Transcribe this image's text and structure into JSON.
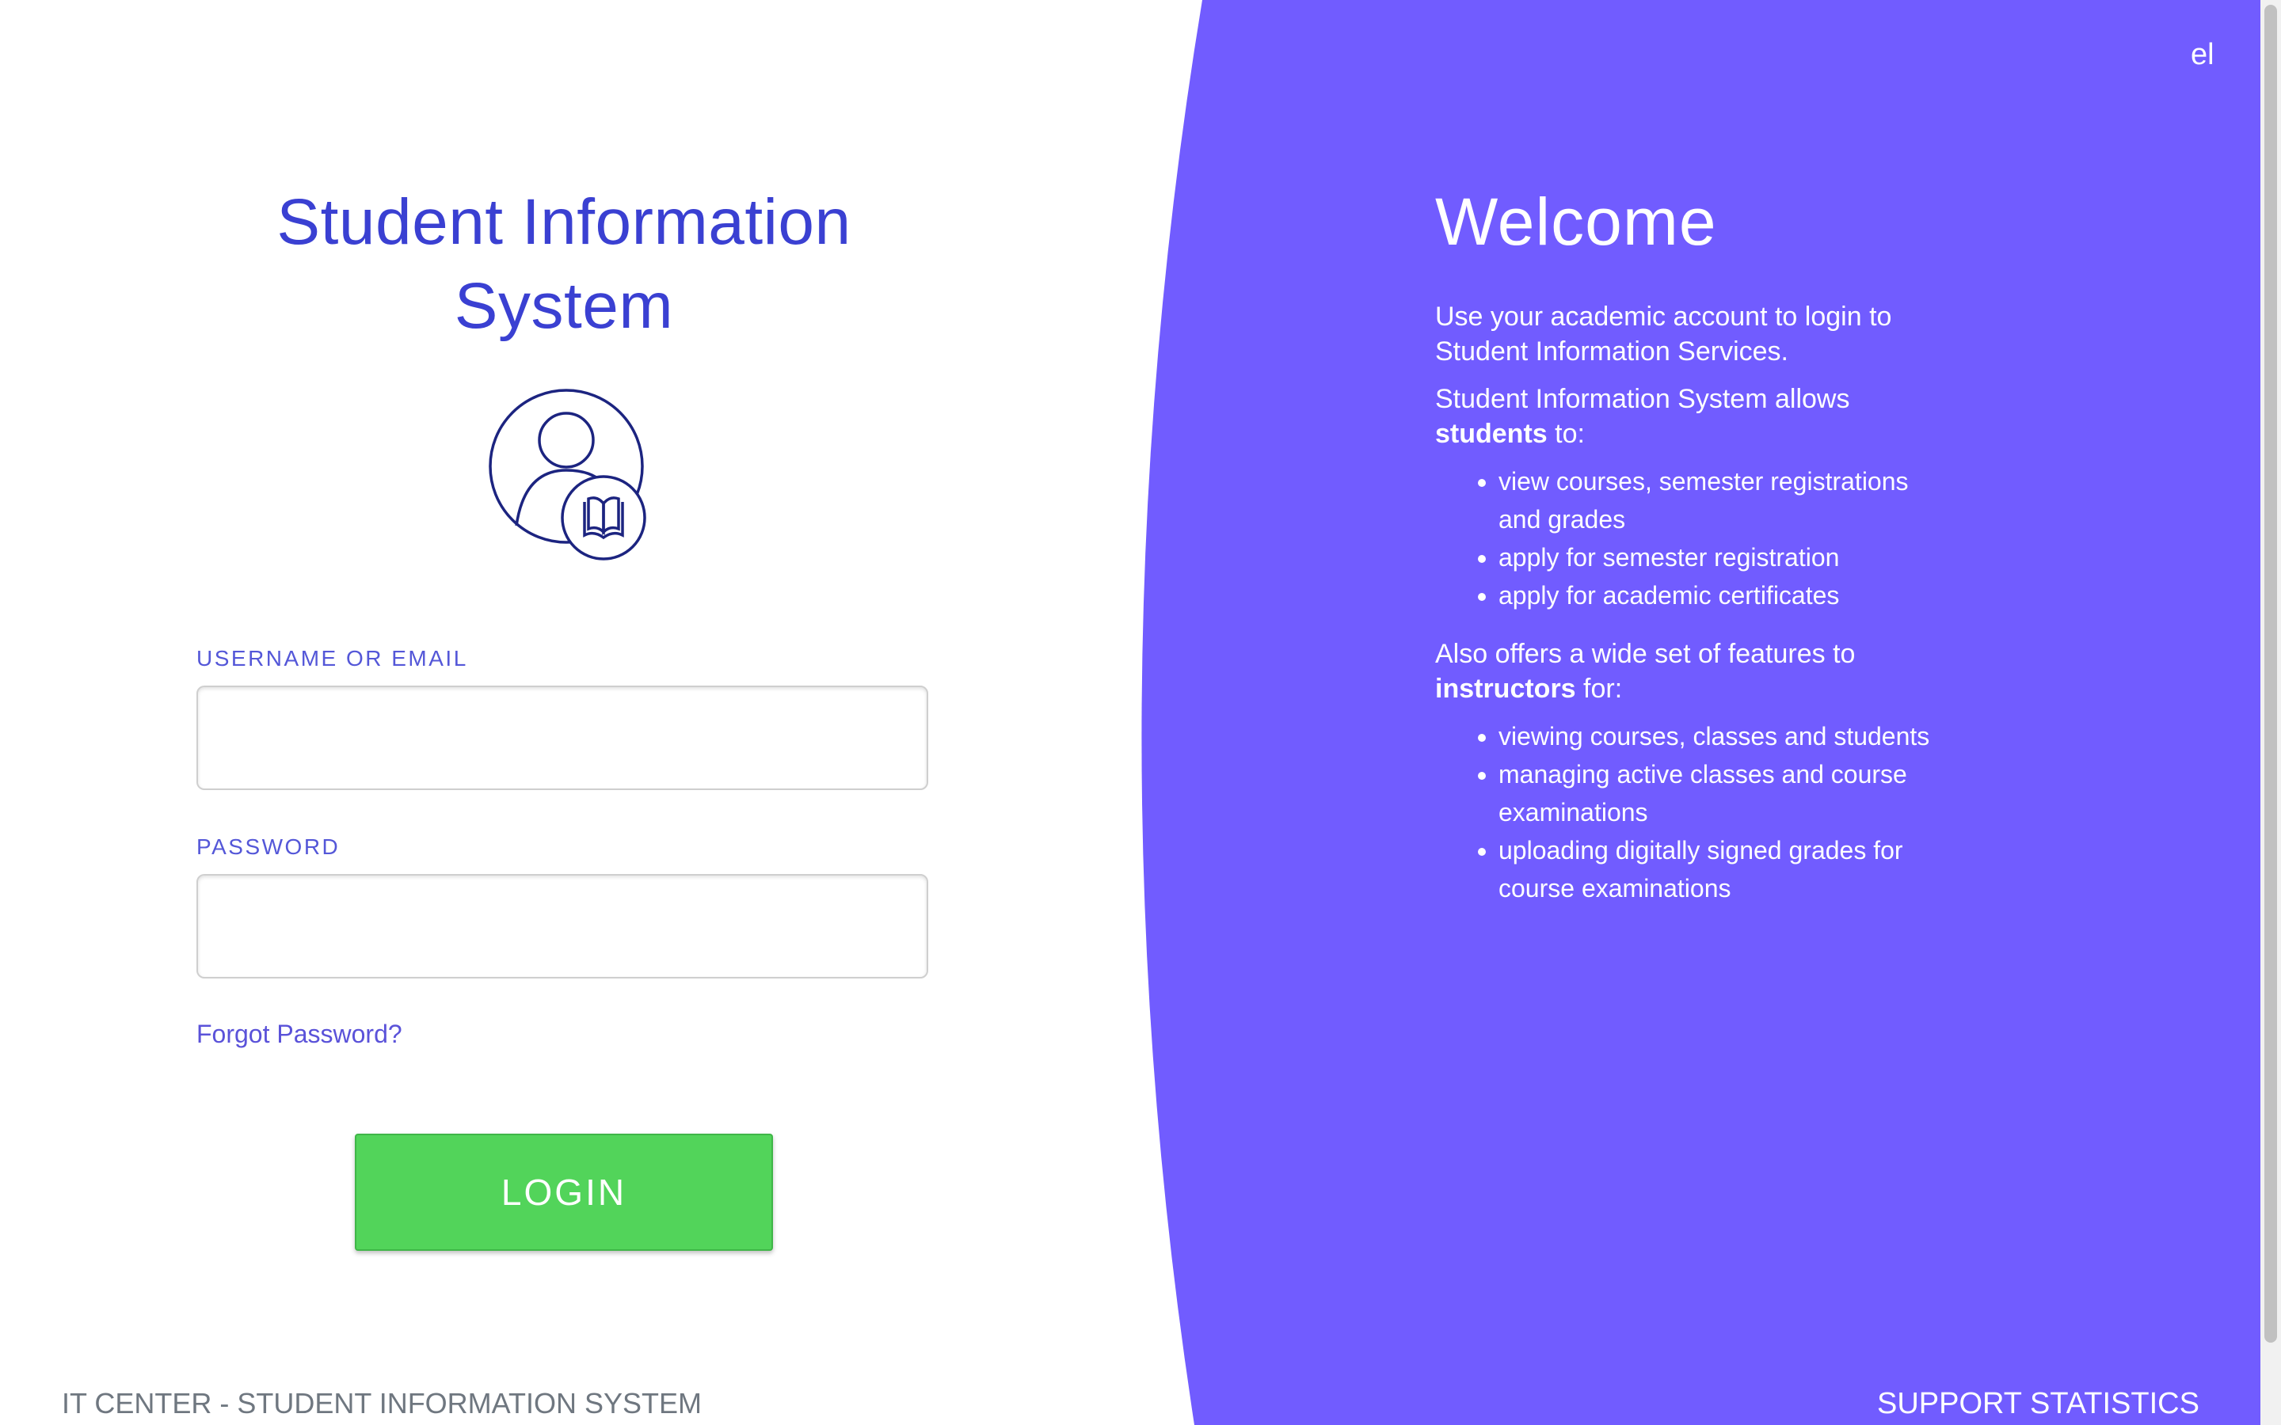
{
  "colors": {
    "accent_purple": "#715cff",
    "title_blue": "#3a40d2",
    "login_green": "#52d45a"
  },
  "login": {
    "title_line1": "Student Information",
    "title_line2": "System",
    "logo_icon": "student-reading-book-icon",
    "username_label": "USERNAME OR EMAIL",
    "username_value": "",
    "password_label": "PASSWORD",
    "password_value": "",
    "forgot_link": "Forgot Password?",
    "login_button": "LOGIN"
  },
  "language": {
    "current": "el"
  },
  "welcome": {
    "heading": "Welcome",
    "intro": "Use your academic account to login to Student Information Services.",
    "students_prefix": "Student Information System allows ",
    "students_bold": "students",
    "students_suffix": " to:",
    "student_features": [
      "view courses, semester registrations and grades",
      "apply for semester registration",
      "apply for academic certificates"
    ],
    "instructors_prefix": "Also offers a wide set of features to ",
    "instructors_bold": "instructors",
    "instructors_suffix": " for:",
    "instructor_features": [
      "viewing courses, classes and students",
      "managing active classes and course examinations",
      "uploading digitally signed grades for course examinations"
    ]
  },
  "footer": {
    "left_text": "IT CENTER - STUDENT INFORMATION SYSTEM",
    "support_link": "SUPPORT",
    "statistics_link": "STATISTICS"
  }
}
